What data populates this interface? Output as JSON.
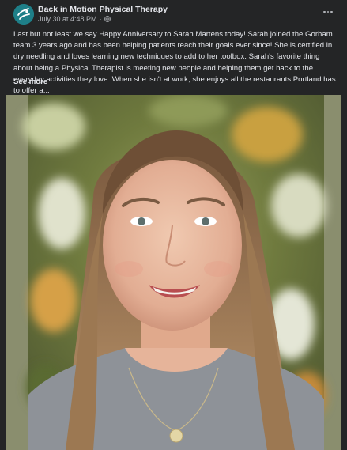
{
  "post": {
    "page_name": "Back in Motion Physical Therapy",
    "timestamp": "July 30 at 4:48 PM",
    "separator": "·",
    "audience_icon": "globe-icon",
    "more_icon": "more-dots-icon",
    "text": "Last but not least we say Happy Anniversary to Sarah Martens today! Sarah joined the Gorham team 3 years ago and has been helping patients reach their goals ever since! She is certified in dry needling and loves learning new techniques to add to her toolbox.  Sarah's favorite thing about being a Physical Therapist is meeting new people and helping them get back to the everyday activities they love. When she isn't at work, she enjoys all the restaurants Portland has to offer a...",
    "see_more": "See more",
    "photo_subject": "portrait-photo"
  },
  "colors": {
    "background": "#242526",
    "primary_text": "#e4e6eb",
    "secondary_text": "#b0b3b8",
    "photo_border": "#8a8e6e",
    "brand_teal": "#1e7f88"
  }
}
